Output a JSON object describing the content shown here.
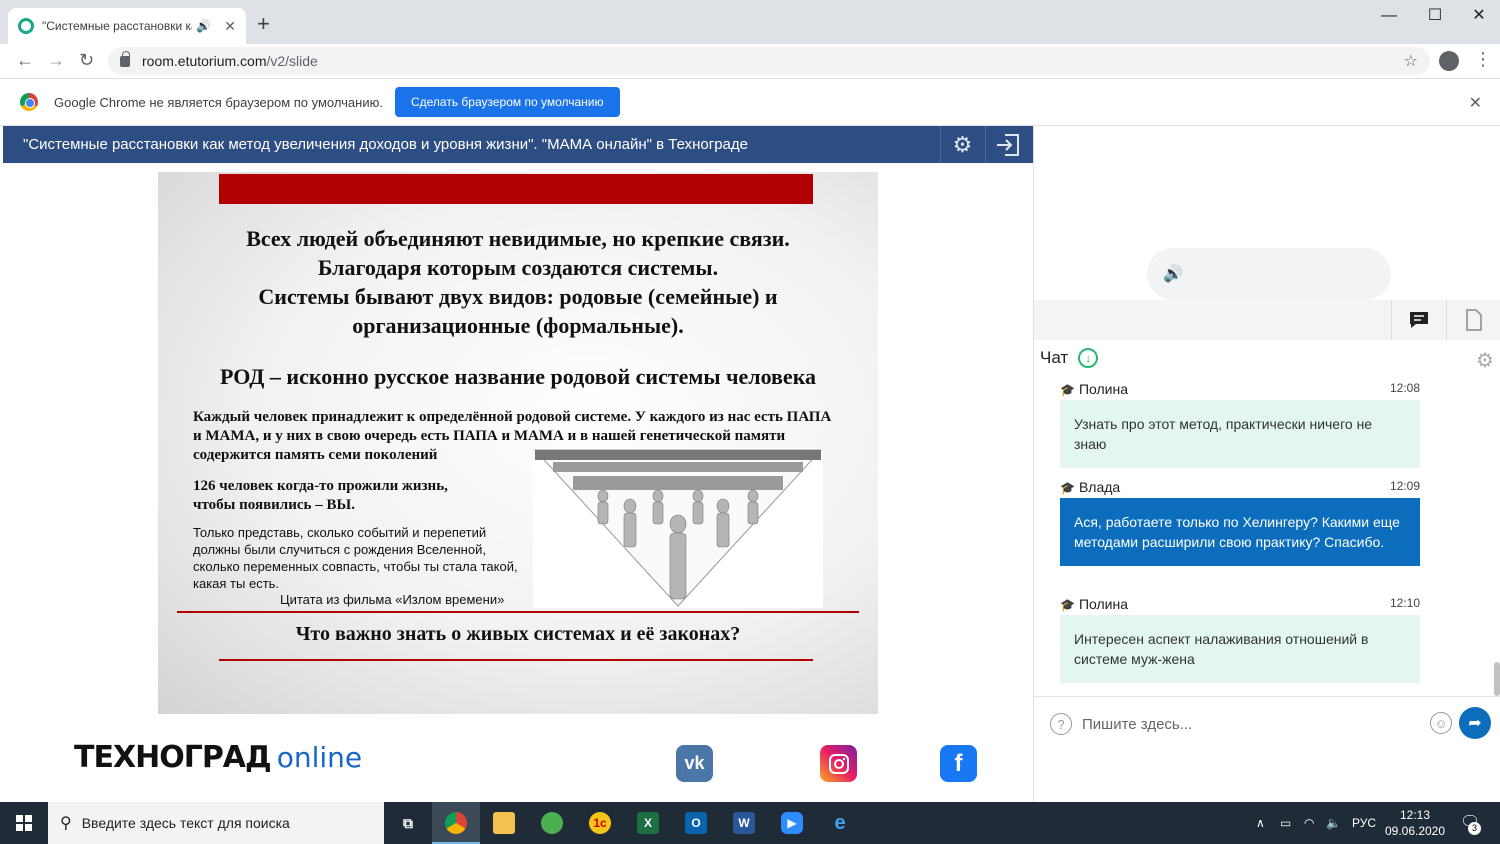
{
  "browser": {
    "tab_title": "\"Системные расстановки ка",
    "url_host": "room.etutorium.com",
    "url_path": "/v2/slide",
    "infobar_text": "Google Chrome не является браузером по умолчанию.",
    "infobar_button": "Сделать браузером по умолчанию"
  },
  "app": {
    "header_title": "\"Системные расстановки как метод увеличения доходов и уровня жизни\". \"МАМА онлайн\" в Технограде"
  },
  "slide": {
    "heading_lines": [
      "Всех людей объединяют невидимые, но крепкие связи.",
      "Благодаря которым создаются системы.",
      "Системы бывают двух видов: родовые (семейные) и",
      "организационные (формальные)."
    ],
    "rod_line": "РОД – исконно русское название родовой системы человека",
    "para1": "Каждый человек принадлежит к определённой родовой системе. У каждого из нас есть ПАПА и МАМА, и у них в свою очередь есть ПАПА и МАМА и в нашей генетической памяти содержится память семи поколений",
    "para2": "126 человек когда-то прожили жизнь, чтобы появились – ВЫ.",
    "para3": "Только представь, сколько событий и перепетий должны были случиться с рождения Вселенной, сколько переменных совпасть, чтобы ты стала такой, какая ты есть.",
    "quote": "Цитата из фильма «Излом времени»",
    "question": "Что важно знать о живых системах и её законах?"
  },
  "footer": {
    "brand_main": "ТЕХНОГРАД",
    "brand_suffix": "online",
    "vk": "vk",
    "fb": "f"
  },
  "chat": {
    "title": "Чат",
    "input_placeholder": "Пишите здесь...",
    "messages": [
      {
        "author": "Полина",
        "time": "12:08",
        "text": "Узнать про этот метод, практически ничего не знаю"
      },
      {
        "author": "Влада",
        "time": "12:09",
        "text": "Ася, работаете только по Хелингеру? Какими еще методами расширили свою практику? Спасибо."
      },
      {
        "author": "Полина",
        "time": "12:10",
        "text": "Интересен аспект налаживания отношений в системе муж-жена"
      }
    ]
  },
  "taskbar": {
    "search_placeholder": "Введите здесь текст для поиска",
    "lang": "РУС",
    "time": "12:13",
    "date": "09.06.2020",
    "notification_count": "3"
  }
}
